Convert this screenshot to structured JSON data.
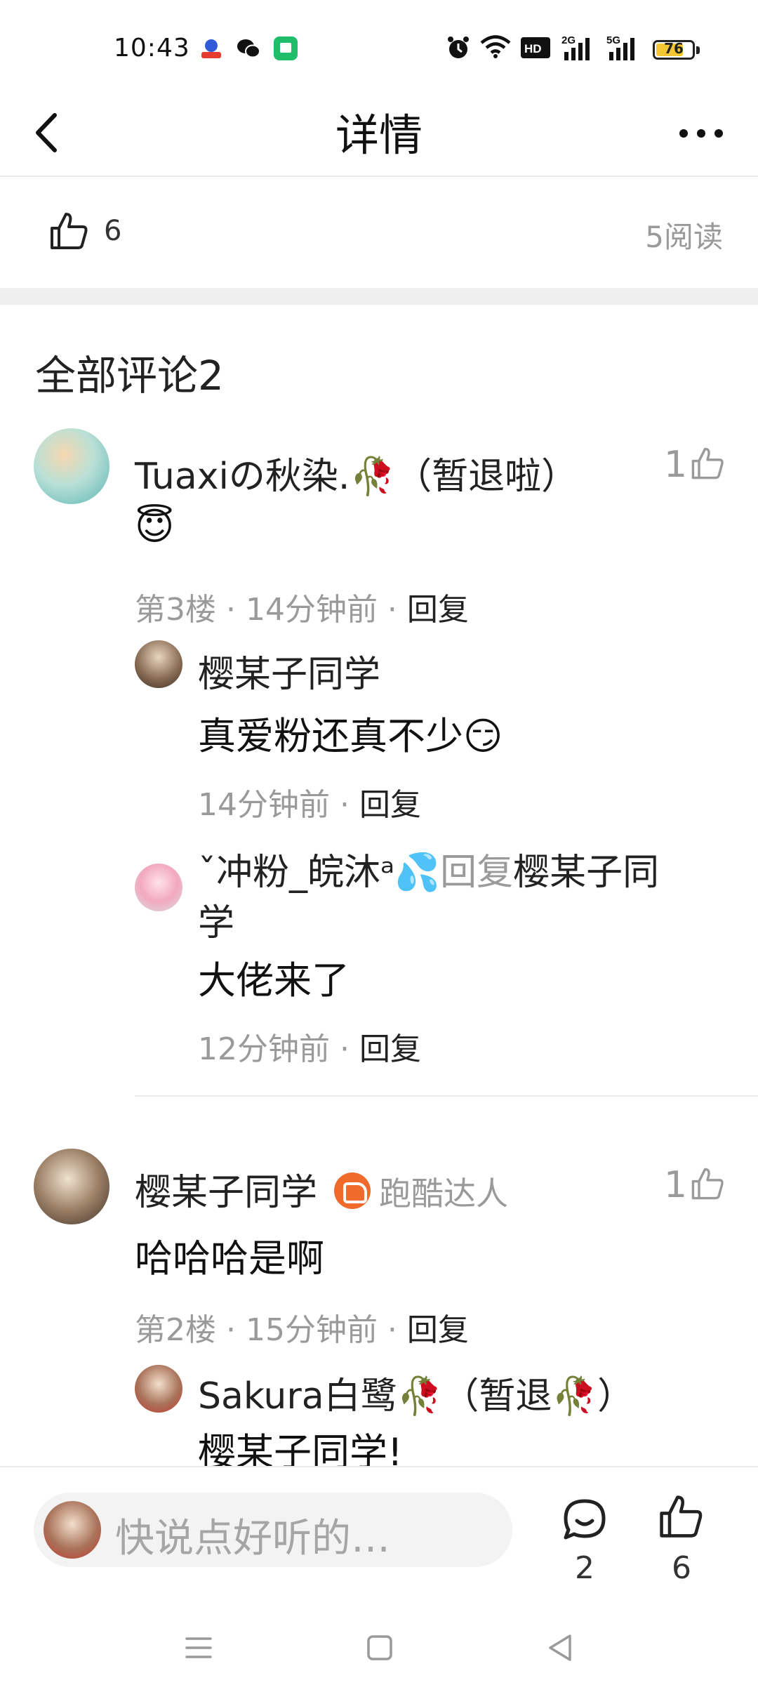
{
  "status_bar": {
    "time": "10:43",
    "network": "HD₂ 2G 5G",
    "battery": "76",
    "battery_level_percent": 76
  },
  "nav": {
    "title": "详情"
  },
  "post_stats": {
    "likes": "6",
    "reads": "5阅读"
  },
  "comments_header": "全部评论2",
  "comments": [
    {
      "name": "Tuaxiの秋染.🥀（暂退啦）",
      "content": "😇",
      "meta_prefix": "第3楼 · 14分钟前 · ",
      "reply_label": "回复",
      "likes": "1",
      "replies": [
        {
          "name": "樱某子同学",
          "content": "真爱粉还真不少😏",
          "meta_prefix": "14分钟前 · ",
          "reply_label": "回复"
        },
        {
          "name": "ˇ冲粉_皖沐ᵃ💦",
          "reply_word": "回复",
          "reply_target": "樱某子同",
          "reply_target_cont": "学",
          "content": "大佬来了",
          "meta_prefix": "12分钟前 · ",
          "reply_label": "回复"
        }
      ]
    },
    {
      "name": "樱某子同学",
      "badge": "跑酷达人",
      "content": "哈哈哈是啊",
      "meta_prefix": "第2楼 · 15分钟前 · ",
      "reply_label": "回复",
      "likes": "1",
      "replies": [
        {
          "name": "Sakura白鹭🥀（暂退🥀）",
          "content": "樱某子同学!"
        }
      ]
    }
  ],
  "bottom_bar": {
    "input_placeholder": "快说点好听的…",
    "comment_count": "2",
    "like_count": "6"
  }
}
